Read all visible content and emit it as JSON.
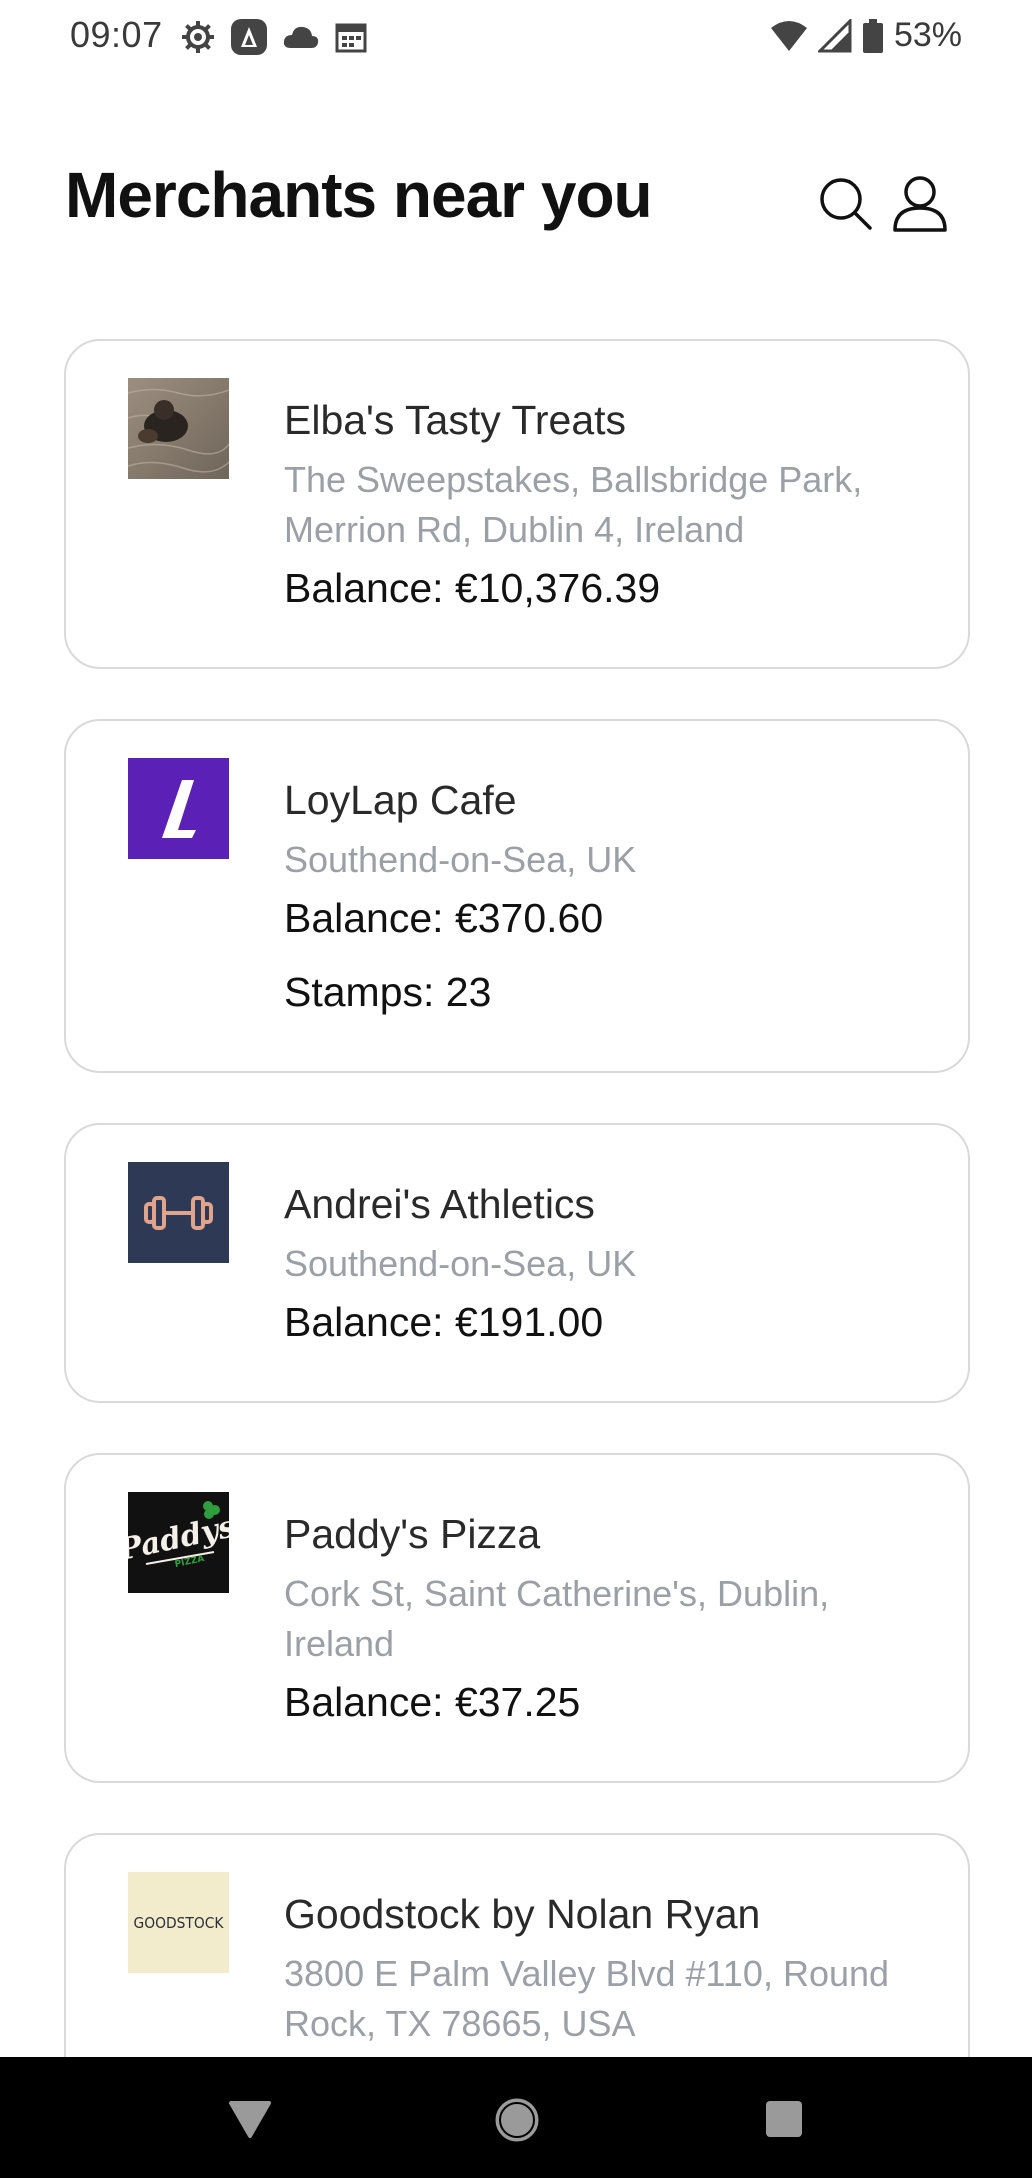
{
  "status_bar": {
    "time": "09:07",
    "battery": "53%",
    "left_icons": [
      "settings-icon",
      "app-a-icon",
      "cloud-icon",
      "calendar-icon"
    ],
    "right_icons": [
      "wifi-icon",
      "signal-icon",
      "battery-icon"
    ]
  },
  "header": {
    "title": "Merchants near you",
    "search_icon": "search-icon",
    "profile_icon": "profile-icon"
  },
  "merchants": [
    {
      "name": "Elba's Tasty Treats",
      "address": "The Sweepstakes, Ballsbridge Park, Merrion Rd, Dublin 4, Ireland",
      "balance": "Balance: €10,376.39",
      "logo": "dog-on-sand-photo"
    },
    {
      "name": "LoyLap Cafe",
      "address": "Southend-on-Sea, UK",
      "balance": "Balance: €370.60",
      "stamps": "Stamps: 23",
      "logo": "loylap-logo",
      "logo_color": "#5b21b6"
    },
    {
      "name": "Andrei's Athletics",
      "address": "Southend-on-Sea, UK",
      "balance": "Balance: €191.00",
      "logo": "dumbbell-icon",
      "logo_color": "#2e3a55"
    },
    {
      "name": "Paddy's Pizza",
      "address": "Cork St, Saint Catherine's, Dublin, Ireland",
      "balance": "Balance: €37.25",
      "logo": "paddys-pizza-logo",
      "logo_text": "Paddys",
      "logo_subtext": "PIZZA"
    },
    {
      "name": "Goodstock by Nolan Ryan",
      "address": "3800 E Palm Valley Blvd #110, Round Rock, TX 78665, USA",
      "logo": "goodstock-logo",
      "logo_text": "GOODSTOCK",
      "logo_color": "#f3eccc"
    }
  ],
  "nav_bar": {
    "back": "back-icon",
    "home": "home-icon",
    "recents": "recents-icon"
  }
}
